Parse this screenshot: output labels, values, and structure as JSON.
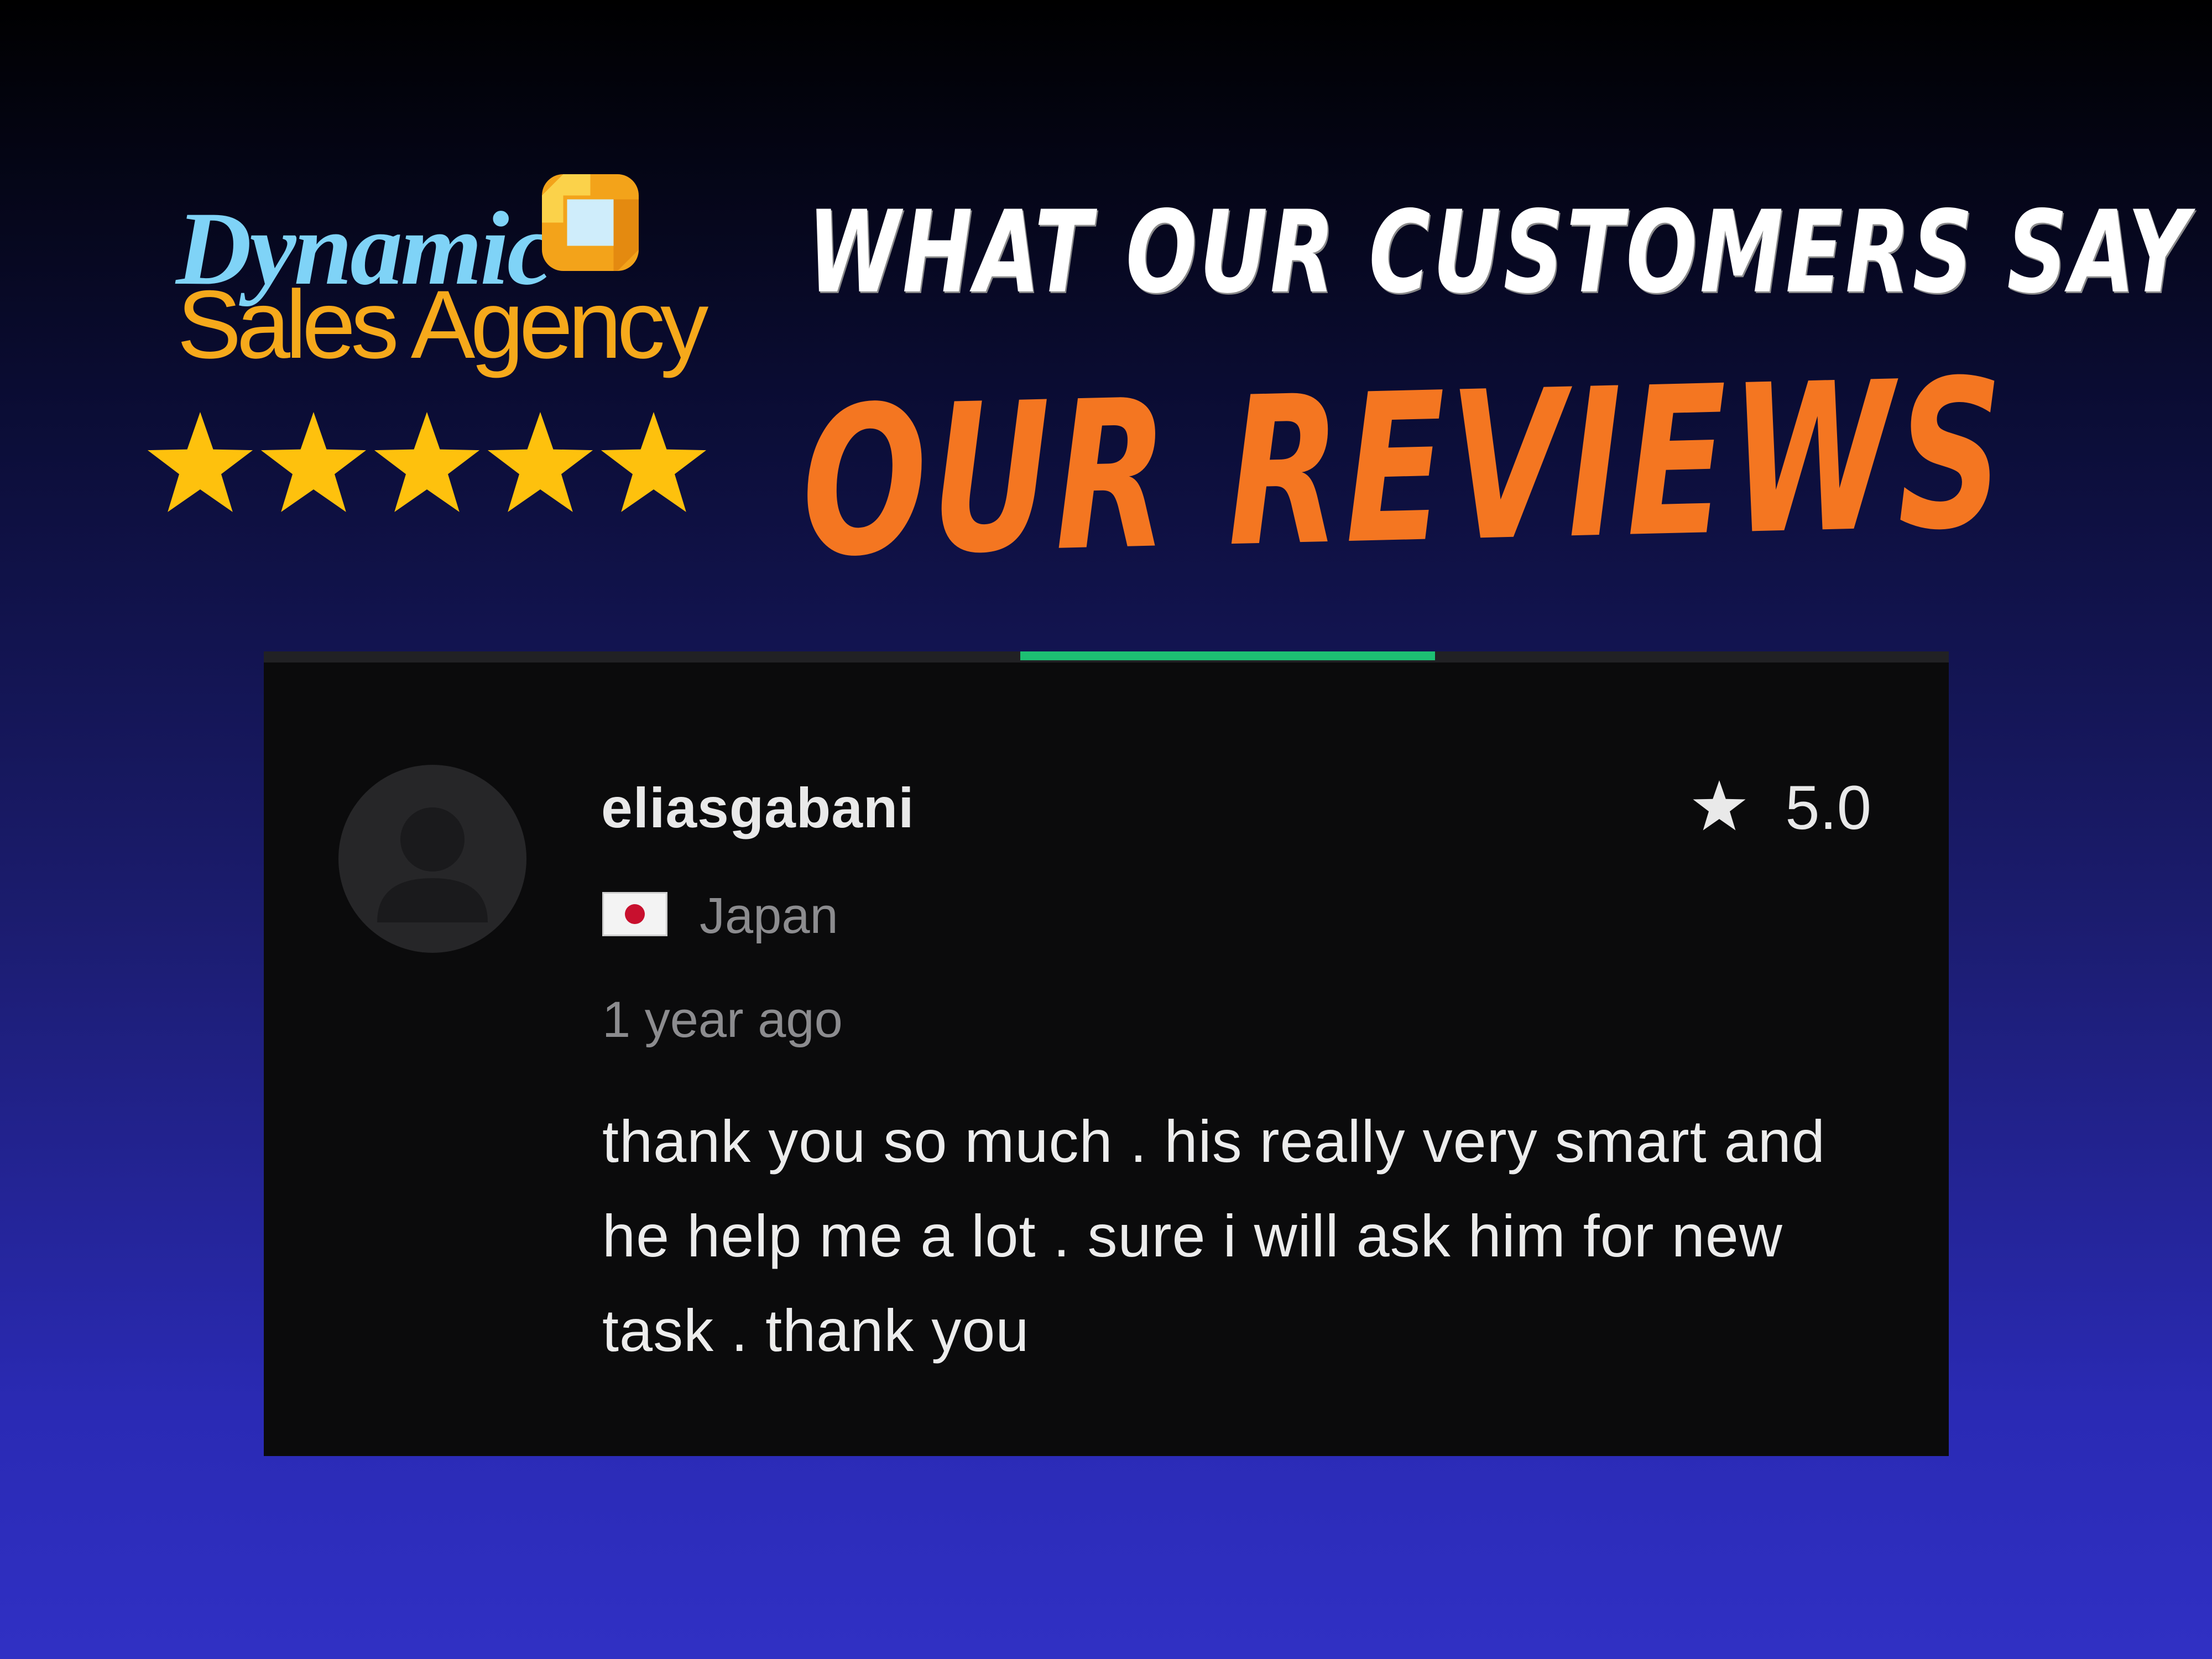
{
  "brand": {
    "line1": "Dynamic",
    "line2": "Sales Agency",
    "logo_icon": "ribbon-square-logo",
    "colors": {
      "blue": "#7fd3f7",
      "orange": "#f6a91b"
    }
  },
  "stars": {
    "rating": 5,
    "max": 5,
    "icon": "star-icon",
    "color": "#fec10d"
  },
  "header": {
    "headline": "WHAT OUR CUSTOMERS SAY",
    "subheadline": "OUR REVIEWS",
    "subheadline_color": "#f47621"
  },
  "review": {
    "reviewer_name": "eliasgabani",
    "rating_value": "5.0",
    "country": "Japan",
    "flag_icon": "japan-flag-icon",
    "timestamp": "1 year ago",
    "text": "thank you so much . his really very smart and he help me a lot . sure i will ask him for new task . thank you",
    "accent_color": "#1dbf73"
  }
}
